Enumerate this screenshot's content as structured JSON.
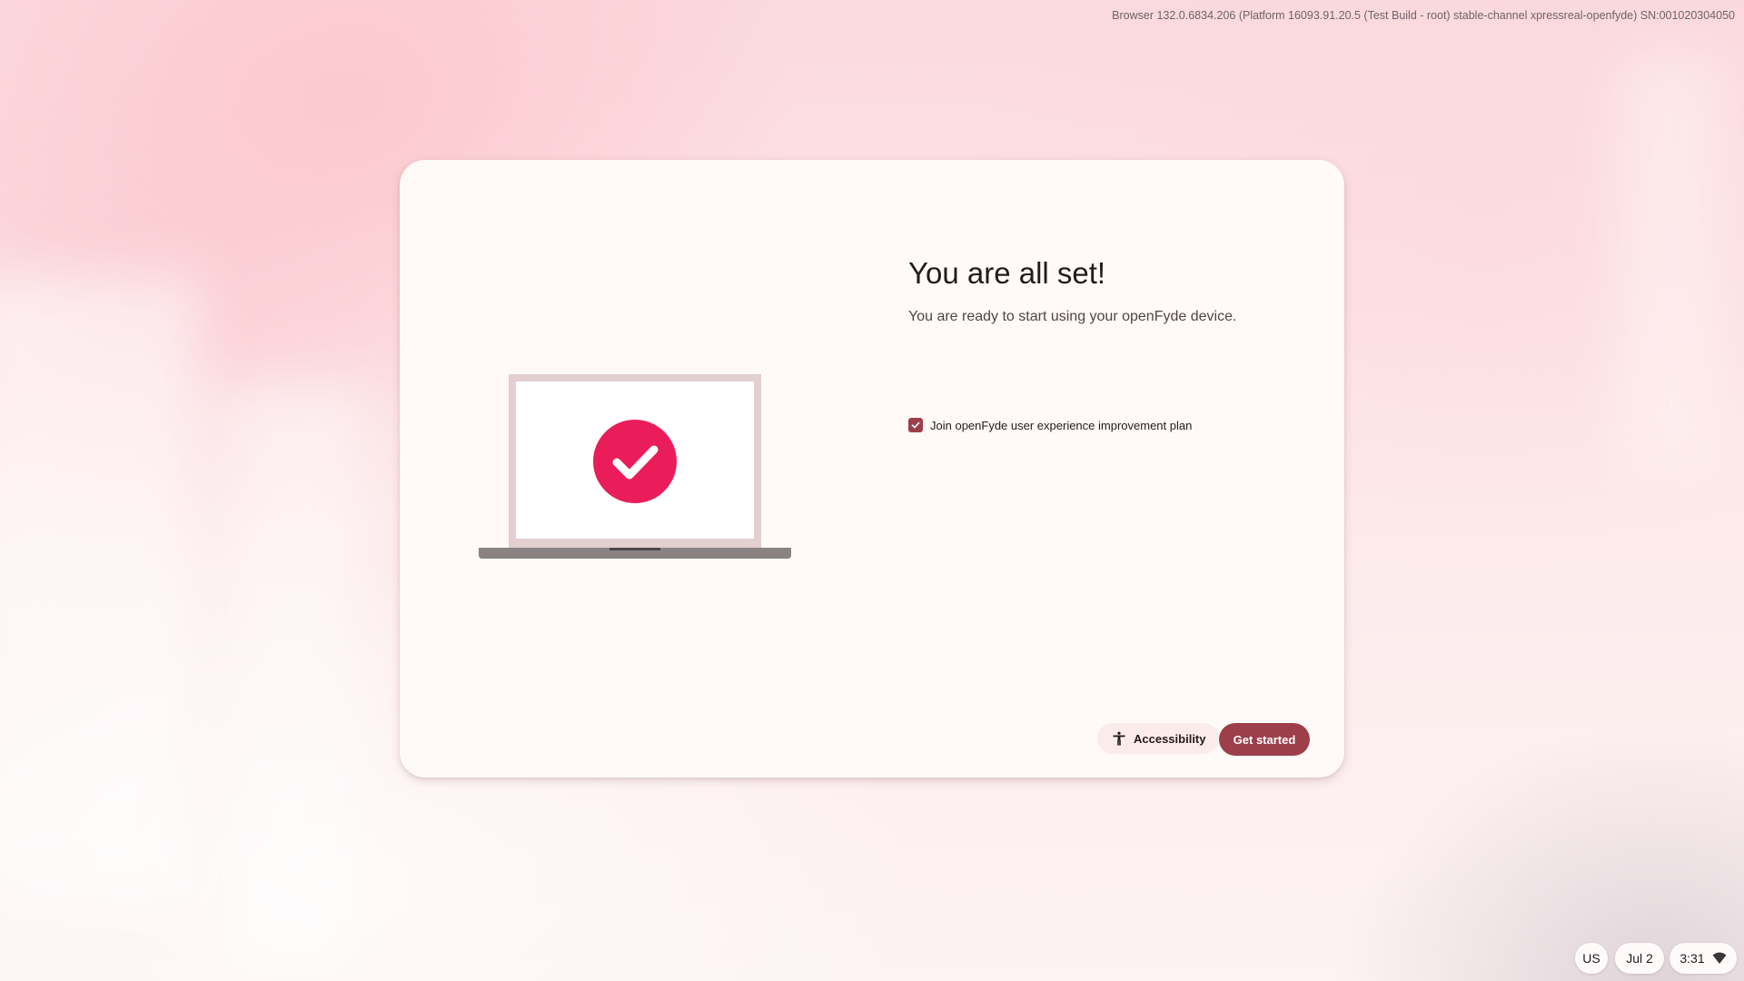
{
  "system": {
    "build_info": "Browser 132.0.6834.206 (Platform 16093.91.20.5 (Test Build - root) stable-channel xpressreal-openfyde) SN:001020304050"
  },
  "dialog": {
    "title": "You are all set!",
    "subtitle": "You are ready to start using your openFyde device.",
    "checkbox_label": "Join openFyde user experience improvement plan",
    "checkbox_checked": true,
    "illustration_icon": "laptop-with-checkmark-icon"
  },
  "footer": {
    "accessibility_label": "Accessibility",
    "get_started_label": "Get started"
  },
  "tray": {
    "keyboard_layout": "US",
    "date": "Jul 2",
    "time": "3:31",
    "network_icon": "wifi-icon"
  },
  "colors": {
    "accent": "#9c3f4a",
    "check_circle": "#ea1d5a",
    "card_bg": "#fffaf8"
  }
}
